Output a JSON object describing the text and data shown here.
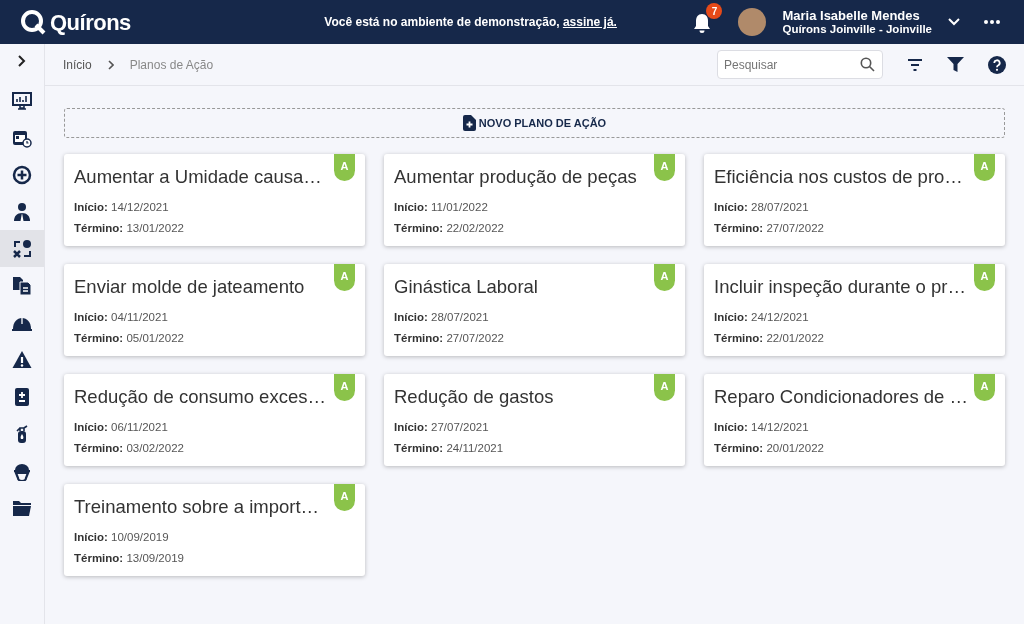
{
  "header": {
    "logo": "Quírons",
    "notice": "Você está no ambiente de demonstração,",
    "notice_link": "assine já.",
    "notifications": "7",
    "user_name": "Maria Isabelle Mendes",
    "user_unit": "Quírons Joinville - Joinville"
  },
  "sidebar": {
    "items": [
      {
        "kind": "dashboard",
        "selected": false
      },
      {
        "kind": "calendar",
        "selected": false
      },
      {
        "kind": "plus",
        "selected": false
      },
      {
        "kind": "person",
        "selected": false
      },
      {
        "kind": "action",
        "selected": true
      },
      {
        "kind": "documents",
        "selected": false
      },
      {
        "kind": "helmet",
        "selected": false
      },
      {
        "kind": "warning",
        "selected": false
      },
      {
        "kind": "clipboard",
        "selected": false
      },
      {
        "kind": "extinguisher",
        "selected": false
      },
      {
        "kind": "worker",
        "selected": false
      },
      {
        "kind": "folder",
        "selected": false
      }
    ]
  },
  "breadcrumb": [
    "Início",
    "Planos de Ação"
  ],
  "search": {
    "placeholder": "Pesquisar"
  },
  "new_button": "NOVO PLANO DE AÇÃO",
  "cards": [
    {
      "title": "Aumentar a Umidade causa…",
      "status": "A",
      "color": "#8bc34a",
      "start": "**Início:** 14/12/2021",
      "end": "**Término:** 13/01/2022"
    },
    {
      "title": "Aumentar produção de peças",
      "status": "A",
      "color": "#8bc34a",
      "start": "**Início:** 11/01/2022",
      "end": "**Término:** 22/02/2022"
    },
    {
      "title": "Eficiência nos custos de pro…",
      "status": "A",
      "color": "#8bc34a",
      "start": "**Início:** 28/07/2021",
      "end": "**Término:** 27/07/2022"
    },
    {
      "title": "Enviar molde de jateamento",
      "status": "A",
      "color": "#8bc34a",
      "start": "**Início:** 04/11/2021",
      "end": "**Término:** 05/01/2022"
    },
    {
      "title": "Ginástica Laboral",
      "status": "A",
      "color": "#8bc34a",
      "start": "**Início:** 28/07/2021",
      "end": "**Término:** 27/07/2022"
    },
    {
      "title": "Incluir inspeção durante o pr…",
      "status": "A",
      "color": "#8bc34a",
      "start": "**Início:** 24/12/2021",
      "end": "**Término:** 22/01/2022"
    },
    {
      "title": "Redução de consumo exces…",
      "status": "A",
      "color": "#8bc34a",
      "start": "**Início:** 06/11/2021",
      "end": "**Término:** 03/02/2022"
    },
    {
      "title": "Redução de gastos",
      "status": "A",
      "color": "#8bc34a",
      "start": "**Início:** 27/07/2021",
      "end": "**Término:** 24/11/2021"
    },
    {
      "title": "Reparo Condicionadores de …",
      "status": "A",
      "color": "#8bc34a",
      "start": "**Início:** 14/12/2021",
      "end": "**Término:** 20/01/2022"
    },
    {
      "title": "Treinamento sobre a import…",
      "status": "A",
      "color": "#8bc34a",
      "start": "**Início:** 10/09/2019",
      "end": "**Término:** 13/09/2019"
    }
  ]
}
